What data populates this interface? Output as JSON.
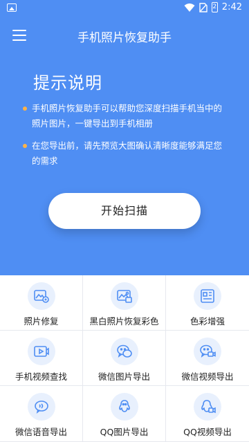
{
  "status_bar": {
    "time": "2:42",
    "battery_level": "2"
  },
  "app_bar": {
    "title": "手机照片恢复助手",
    "menu_icon": "hamburger-menu-icon"
  },
  "intro": {
    "heading": "提示说明",
    "tips": [
      {
        "line1": "手机照片恢复助手可以帮助您深度扫描手机当中的",
        "line2": "照片图片，一键导出到手机相册"
      },
      {
        "line1": "在您导出前，请先预览大图确认清晰度能够满足您",
        "line2": "的需求"
      }
    ]
  },
  "scan_button": {
    "label": "开始扫描"
  },
  "features": [
    {
      "label": "照片修复",
      "icon": "photo-repair-icon"
    },
    {
      "label": "黑白照片恢复彩色",
      "icon": "bw-to-color-icon"
    },
    {
      "label": "色彩增强",
      "icon": "color-enhance-icon"
    },
    {
      "label": "手机视频查找",
      "icon": "video-find-icon"
    },
    {
      "label": "微信图片导出",
      "icon": "wechat-image-export-icon"
    },
    {
      "label": "微信视频导出",
      "icon": "wechat-video-export-icon"
    },
    {
      "label": "微信语音导出",
      "icon": "wechat-voice-export-icon"
    },
    {
      "label": "QQ图片导出",
      "icon": "qq-image-export-icon"
    },
    {
      "label": "QQ视频导出",
      "icon": "qq-video-export-icon"
    }
  ],
  "colors": {
    "primary": "#4f8ef3",
    "bullet": "#ffb347",
    "icon_bg": "#e8f0fd",
    "icon_stroke": "#4f8ef3"
  }
}
